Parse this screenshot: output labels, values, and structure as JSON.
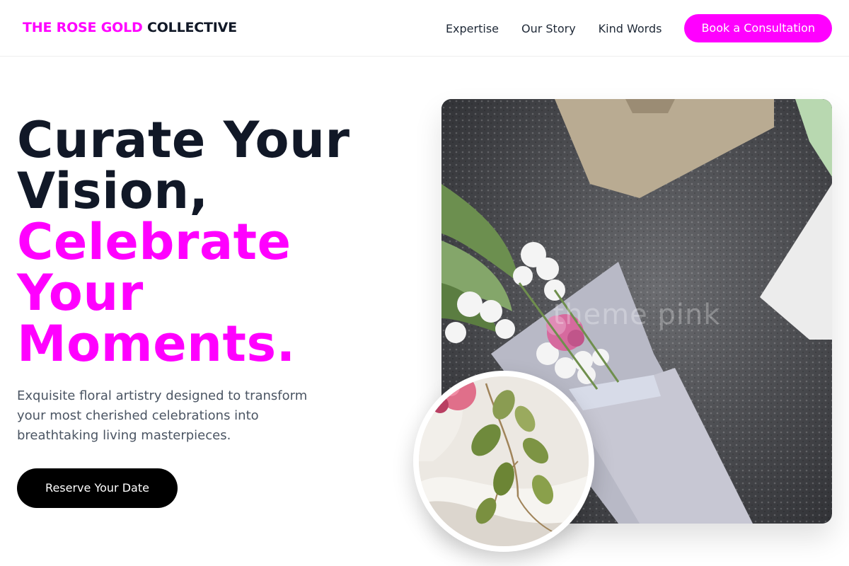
{
  "header": {
    "brand_accent": "THE ROSE GOLD",
    "brand_rest": "COLLECTIVE",
    "nav": [
      {
        "label": "Expertise"
      },
      {
        "label": "Our Story"
      },
      {
        "label": "Kind Words"
      }
    ],
    "cta_label": "Book a Consultation"
  },
  "hero": {
    "headline_lines_dark": [
      "Curate Your",
      "Vision,"
    ],
    "headline_lines_accent": [
      "Celebrate",
      "Your",
      "Moments."
    ],
    "subtext": "Exquisite floral artistry designed to transform your most cherished celebrations into breathtaking living masterpieces.",
    "button_label": "Reserve Your Date",
    "image_watermark": "theme pink"
  },
  "colors": {
    "accent": "#ff00ff",
    "dark_text": "#111827",
    "button_dark": "#000000",
    "body_text": "#4b5563"
  }
}
